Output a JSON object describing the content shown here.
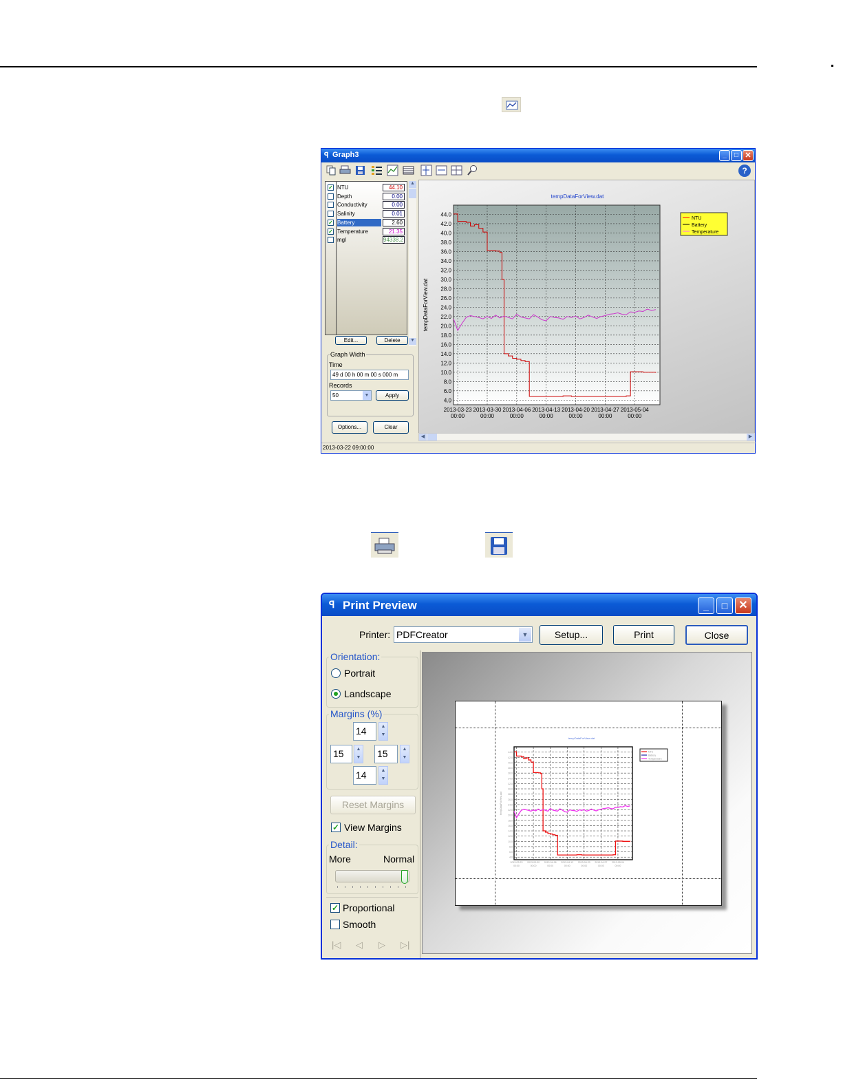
{
  "graph_window": {
    "title": "Graph3",
    "channels": [
      {
        "name": "NTU",
        "checked": true,
        "value": "44.10",
        "color": "#cc0000",
        "selected": false
      },
      {
        "name": "Depth",
        "checked": false,
        "value": "0.00",
        "color": "#000080",
        "selected": false
      },
      {
        "name": "Conductivity",
        "checked": false,
        "value": "0.00",
        "color": "#000080",
        "selected": false
      },
      {
        "name": "Salinity",
        "checked": false,
        "value": "0.01",
        "color": "#000080",
        "selected": false
      },
      {
        "name": "Battery",
        "checked": true,
        "value": "2.60",
        "color": "#000000",
        "selected": true
      },
      {
        "name": "Temperature",
        "checked": true,
        "value": "21.35",
        "color": "#cc00cc",
        "selected": false
      },
      {
        "name": "mgl",
        "checked": false,
        "value": "94338.2",
        "color": "#559955",
        "selected": false
      }
    ],
    "edit_label": "Edit...",
    "delete_label": "Delete",
    "graph_width_label": "Graph Width",
    "time_label": "Time",
    "time_value": "49 d 00 h 00 m 00 s 000 m",
    "records_label": "Records",
    "records_value": "50",
    "apply_label": "Apply",
    "options_label": "Options...",
    "clear_label": "Clear",
    "status_text": "2013-03-22 09:00:00"
  },
  "chart_data": {
    "type": "line",
    "title": "tempDataForView.dat",
    "ylabel": "tempDataForView.dat",
    "xlabel": "",
    "ylim": [
      3,
      46
    ],
    "xlim": [
      0,
      49
    ],
    "y_ticks": [
      "4.0",
      "6.0",
      "8.0",
      "10.0",
      "12.0",
      "14.0",
      "16.0",
      "18.0",
      "20.0",
      "22.0",
      "24.0",
      "26.0",
      "28.0",
      "30.0",
      "32.0",
      "34.0",
      "36.0",
      "38.0",
      "40.0",
      "42.0",
      "44.0"
    ],
    "x_ticks": [
      {
        "d": 2013,
        "label": "2013-03-23",
        "sub": "00:00"
      },
      {
        "label": "2013-03-30",
        "sub": "00:00"
      },
      {
        "label": "2013-04-06",
        "sub": "00:00"
      },
      {
        "label": "2013-04-13",
        "sub": "00:00"
      },
      {
        "label": "2013-04-20",
        "sub": "00:00"
      },
      {
        "label": "2013-04-27",
        "sub": "00:00"
      },
      {
        "label": "2013-05-04",
        "sub": "00:00"
      }
    ],
    "x_tick_days": [
      1,
      8,
      15,
      22,
      29,
      36,
      43
    ],
    "legend": [
      "NTU",
      "Battery",
      "Temperature"
    ],
    "legend_colors": [
      "#ff0000",
      "#000000",
      "#ff66ff"
    ],
    "series": [
      {
        "name": "NTU",
        "color": "#cc0000",
        "x": [
          0,
          1,
          3,
          4,
          5,
          6,
          7,
          8,
          10,
          11,
          11.5,
          12,
          13,
          14,
          15,
          16,
          17,
          18,
          19,
          20,
          21,
          22,
          24,
          26,
          28,
          30,
          32,
          34,
          36,
          38,
          40,
          41,
          42,
          43,
          44,
          45,
          46,
          47,
          48
        ],
        "y": [
          44.1,
          42.5,
          42.3,
          41.5,
          41.8,
          41.0,
          40.2,
          36.2,
          36.1,
          35.8,
          30.0,
          14.0,
          13.5,
          13.0,
          12.8,
          12.5,
          12.3,
          4.8,
          4.8,
          4.8,
          4.8,
          4.8,
          4.8,
          4.9,
          4.8,
          4.8,
          4.8,
          4.8,
          4.8,
          4.8,
          4.8,
          4.9,
          10.1,
          10.1,
          10.1,
          10.0,
          10.0,
          10.0,
          9.9
        ]
      },
      {
        "name": "Temperature",
        "color": "#cc33cc",
        "x": [
          0,
          1,
          2,
          3,
          4,
          5,
          6,
          7,
          8,
          9,
          10,
          11,
          12,
          13,
          14,
          15,
          16,
          17,
          18,
          19,
          20,
          21,
          22,
          23,
          24,
          25,
          26,
          27,
          28,
          29,
          30,
          31,
          32,
          33,
          34,
          35,
          36,
          37,
          38,
          39,
          40,
          41,
          42,
          43,
          44,
          45,
          46,
          47,
          48
        ],
        "y": [
          21.5,
          19.0,
          20.5,
          21.8,
          22.2,
          22.0,
          21.8,
          21.5,
          22.0,
          21.6,
          22.3,
          21.7,
          22.1,
          21.8,
          21.5,
          22.5,
          21.9,
          21.7,
          21.5,
          22.4,
          21.9,
          21.3,
          21.1,
          22.0,
          21.8,
          21.7,
          21.4,
          22.0,
          21.8,
          22.1,
          21.5,
          21.8,
          22.3,
          21.9,
          21.6,
          22.0,
          22.2,
          22.5,
          22.6,
          22.8,
          22.5,
          22.4,
          23.0,
          22.9,
          23.2,
          23.1,
          23.6,
          23.3,
          23.5
        ]
      }
    ]
  },
  "print_preview": {
    "title": "Print Preview",
    "printer_label": "Printer:",
    "printer_value": "PDFCreator",
    "setup_label": "Setup...",
    "print_label": "Print",
    "close_label": "Close",
    "orientation_label": "Orientation:",
    "portrait_label": "Portrait",
    "landscape_label": "Landscape",
    "orientation_selected": "Landscape",
    "margins_label": "Margins (%)",
    "margin_top": "14",
    "margin_left": "15",
    "margin_right": "15",
    "margin_bottom": "14",
    "reset_margins_label": "Reset Margins",
    "view_margins_label": "View Margins",
    "view_margins_checked": true,
    "detail_label": "Detail:",
    "detail_more": "More",
    "detail_normal": "Normal",
    "detail_level": 1.0,
    "proportional_label": "Proportional",
    "proportional_checked": true,
    "smooth_label": "Smooth",
    "smooth_checked": false
  },
  "icons": {
    "graph_icon": "graph-window-icon",
    "print_icon": "printer-icon",
    "save_icon": "floppy-disk-icon"
  }
}
